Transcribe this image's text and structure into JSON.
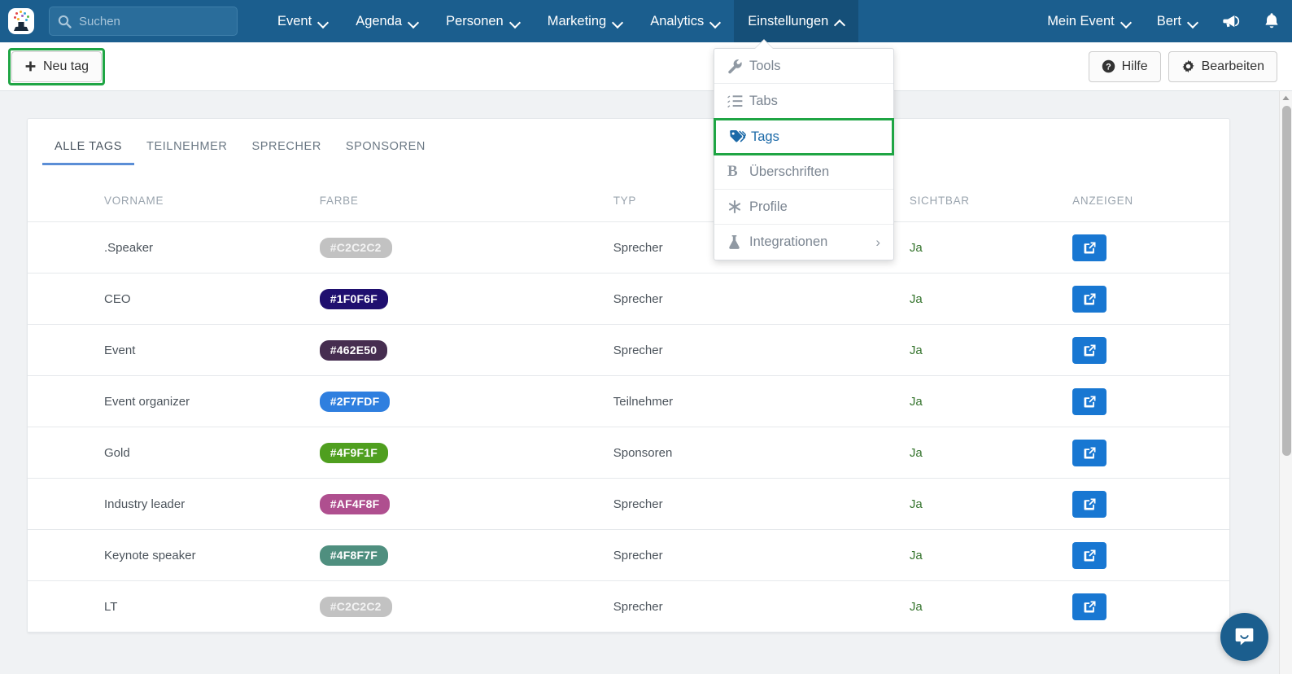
{
  "topnav": {
    "logo_alt": "app-logo",
    "search": {
      "placeholder": "Suchen",
      "value": ""
    },
    "items": [
      {
        "label": "Event",
        "icon": "chevron-down-icon",
        "active": false
      },
      {
        "label": "Agenda",
        "icon": "chevron-down-icon",
        "active": false
      },
      {
        "label": "Personen",
        "icon": "chevron-down-icon",
        "active": false
      },
      {
        "label": "Marketing",
        "icon": "chevron-down-icon",
        "active": false
      },
      {
        "label": "Analytics",
        "icon": "chevron-down-icon",
        "active": false
      },
      {
        "label": "Einstellungen",
        "icon": "chevron-up-icon",
        "active": true
      }
    ],
    "right_items": [
      {
        "label": "Mein Event",
        "icon": "chevron-down-icon"
      },
      {
        "label": "Bert",
        "icon": "chevron-down-icon"
      }
    ],
    "right_icons": [
      {
        "name": "megaphone-icon"
      },
      {
        "name": "bell-icon"
      }
    ],
    "accent_bg": "#1b5e8e",
    "accent_active_bg": "#154f78"
  },
  "toolbar": {
    "new_tag_label": "Neu tag",
    "new_tag_icon": "plus-icon",
    "new_tag_highlight_color": "#1fa544",
    "help_label": "Hilfe",
    "help_icon": "question-circle-icon",
    "edit_label": "Bearbeiten",
    "edit_icon": "gear-icon"
  },
  "dropdown": {
    "open": true,
    "items": [
      {
        "label": "Tools",
        "icon": "wrench-icon",
        "highlighted": false,
        "submenu": false
      },
      {
        "label": "Tabs",
        "icon": "list-icon",
        "highlighted": false,
        "submenu": false
      },
      {
        "label": "Tags",
        "icon": "tags-icon",
        "highlighted": true,
        "submenu": false
      },
      {
        "label": "Überschriften",
        "icon": "bold-b-icon",
        "highlighted": false,
        "submenu": false
      },
      {
        "label": "Profile",
        "icon": "asterisk-icon",
        "highlighted": false,
        "submenu": false
      },
      {
        "label": "Integrationen",
        "icon": "flask-icon",
        "highlighted": false,
        "submenu": true
      }
    ],
    "highlight_color": "#1fa544",
    "highlight_text_color": "#1c6aa8",
    "submenu_icon": "chevron-right-icon"
  },
  "card": {
    "tabs": [
      {
        "label": "ALLE TAGS",
        "active": true
      },
      {
        "label": "TEILNEHMER",
        "active": false
      },
      {
        "label": "SPRECHER",
        "active": false
      },
      {
        "label": "SPONSOREN",
        "active": false
      }
    ],
    "active_tab_color": "#5b8ed6",
    "table": {
      "columns": [
        "VORNAME",
        "FARBE",
        "TYP",
        "SICHTBAR",
        "ANZEIGEN"
      ],
      "action_icon": "external-link-icon",
      "action_color": "#1877d2",
      "visible_text_color": "#35742d",
      "rows": [
        {
          "vorname": ".Speaker",
          "farbe": "#C2C2C2",
          "typ": "Sprecher",
          "sichtbar": "Ja"
        },
        {
          "vorname": "CEO",
          "farbe": "#1F0F6F",
          "typ": "Sprecher",
          "sichtbar": "Ja"
        },
        {
          "vorname": "Event",
          "farbe": "#462E50",
          "typ": "Sprecher",
          "sichtbar": "Ja"
        },
        {
          "vorname": "Event organizer",
          "farbe": "#2F7FDF",
          "typ": "Teilnehmer",
          "sichtbar": "Ja"
        },
        {
          "vorname": "Gold",
          "farbe": "#4F9F1F",
          "typ": "Sponsoren",
          "sichtbar": "Ja"
        },
        {
          "vorname": "Industry leader",
          "farbe": "#AF4F8F",
          "typ": "Sprecher",
          "sichtbar": "Ja"
        },
        {
          "vorname": "Keynote speaker",
          "farbe": "#4F8F7F",
          "typ": "Sprecher",
          "sichtbar": "Ja"
        },
        {
          "vorname": "LT",
          "farbe": "#C2C2C2",
          "typ": "Sprecher",
          "sichtbar": "Ja"
        }
      ]
    }
  },
  "chat": {
    "icon": "chat-bubble-icon",
    "color": "#1b5e8e"
  },
  "scrollbar": {
    "up_icon": "caret-up-icon"
  }
}
